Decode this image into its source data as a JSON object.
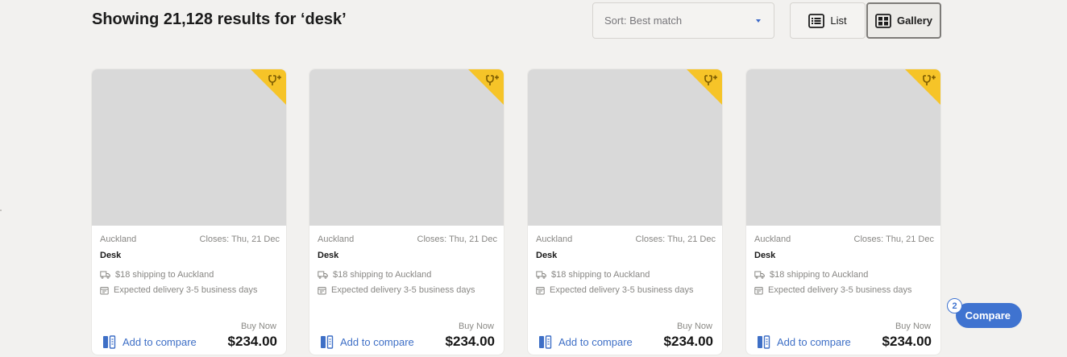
{
  "header": {
    "results_title": "Showing 21,128 results for ‘desk’"
  },
  "sort": {
    "label": "Sort: Best match",
    "icon": "chevron-down-icon"
  },
  "view_toggle": {
    "list_label": "List",
    "gallery_label": "Gallery",
    "selected": "Gallery"
  },
  "listings": [
    {
      "location": "Auckland",
      "closes": "Closes: Thu, 21 Dec",
      "title": "Desk",
      "shipping": "$18 shipping to Auckland",
      "delivery": "Expected delivery 3-5 business days",
      "buy_label": "Buy Now",
      "price": "$234.00",
      "compare_label": "Add to compare"
    },
    {
      "location": "Auckland",
      "closes": "Closes: Thu, 21 Dec",
      "title": "Desk",
      "shipping": "$18 shipping to Auckland",
      "delivery": "Expected delivery 3-5 business days",
      "buy_label": "Buy Now",
      "price": "$234.00",
      "compare_label": "Add to compare"
    },
    {
      "location": "Auckland",
      "closes": "Closes: Thu, 21 Dec",
      "title": "Desk",
      "shipping": "$18 shipping to Auckland",
      "delivery": "Expected delivery 3-5 business days",
      "buy_label": "Buy Now",
      "price": "$234.00",
      "compare_label": "Add to compare"
    },
    {
      "location": "Auckland",
      "closes": "Closes: Thu, 21 Dec",
      "title": "Desk",
      "shipping": "$18 shipping to Auckland",
      "delivery": "Expected delivery 3-5 business days",
      "buy_label": "Buy Now",
      "price": "$234.00",
      "compare_label": "Add to compare"
    }
  ],
  "compare": {
    "count": "2",
    "label": "Compare"
  },
  "colors": {
    "accent": "#3f73d0",
    "badge": "#f6c428",
    "image_placeholder": "#d9d9d9"
  }
}
